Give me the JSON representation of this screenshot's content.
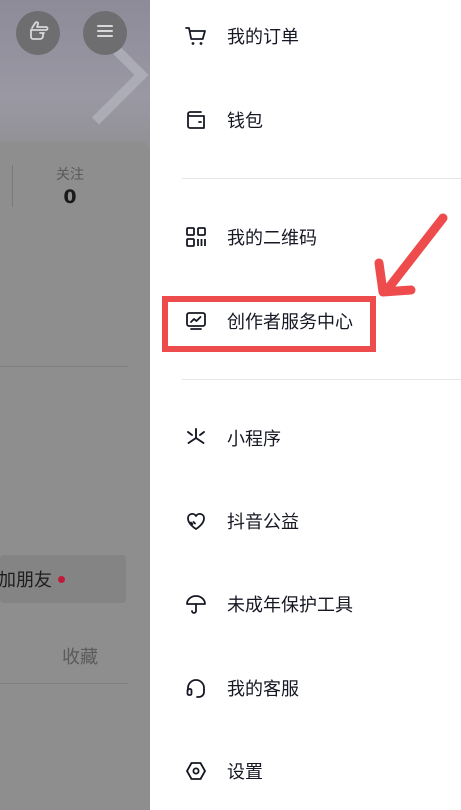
{
  "background_profile": {
    "stat_label": "关注",
    "stat_value": "0",
    "add_friend_label": "加朋友",
    "favorites_tab": "收藏"
  },
  "menu": {
    "my_orders": "我的订单",
    "wallet": "钱包",
    "my_qr_code": "我的二维码",
    "creator_center": "创作者服务中心",
    "mini_programs": "小程序",
    "douyin_charity": "抖音公益",
    "minor_protection": "未成年保护工具",
    "customer_service": "我的客服",
    "settings": "设置"
  },
  "annotation": {
    "highlighted_item": "creator_center",
    "color": "#ee4b4c"
  },
  "icons": {
    "my_orders": "cart-icon",
    "wallet": "wallet-icon",
    "my_qr_code": "qr-code-icon",
    "creator_center": "monitor-chart-icon",
    "mini_programs": "asterisk-icon",
    "douyin_charity": "heart-icon",
    "minor_protection": "umbrella-icon",
    "customer_service": "headset-icon",
    "settings": "hexagon-gear-icon"
  }
}
